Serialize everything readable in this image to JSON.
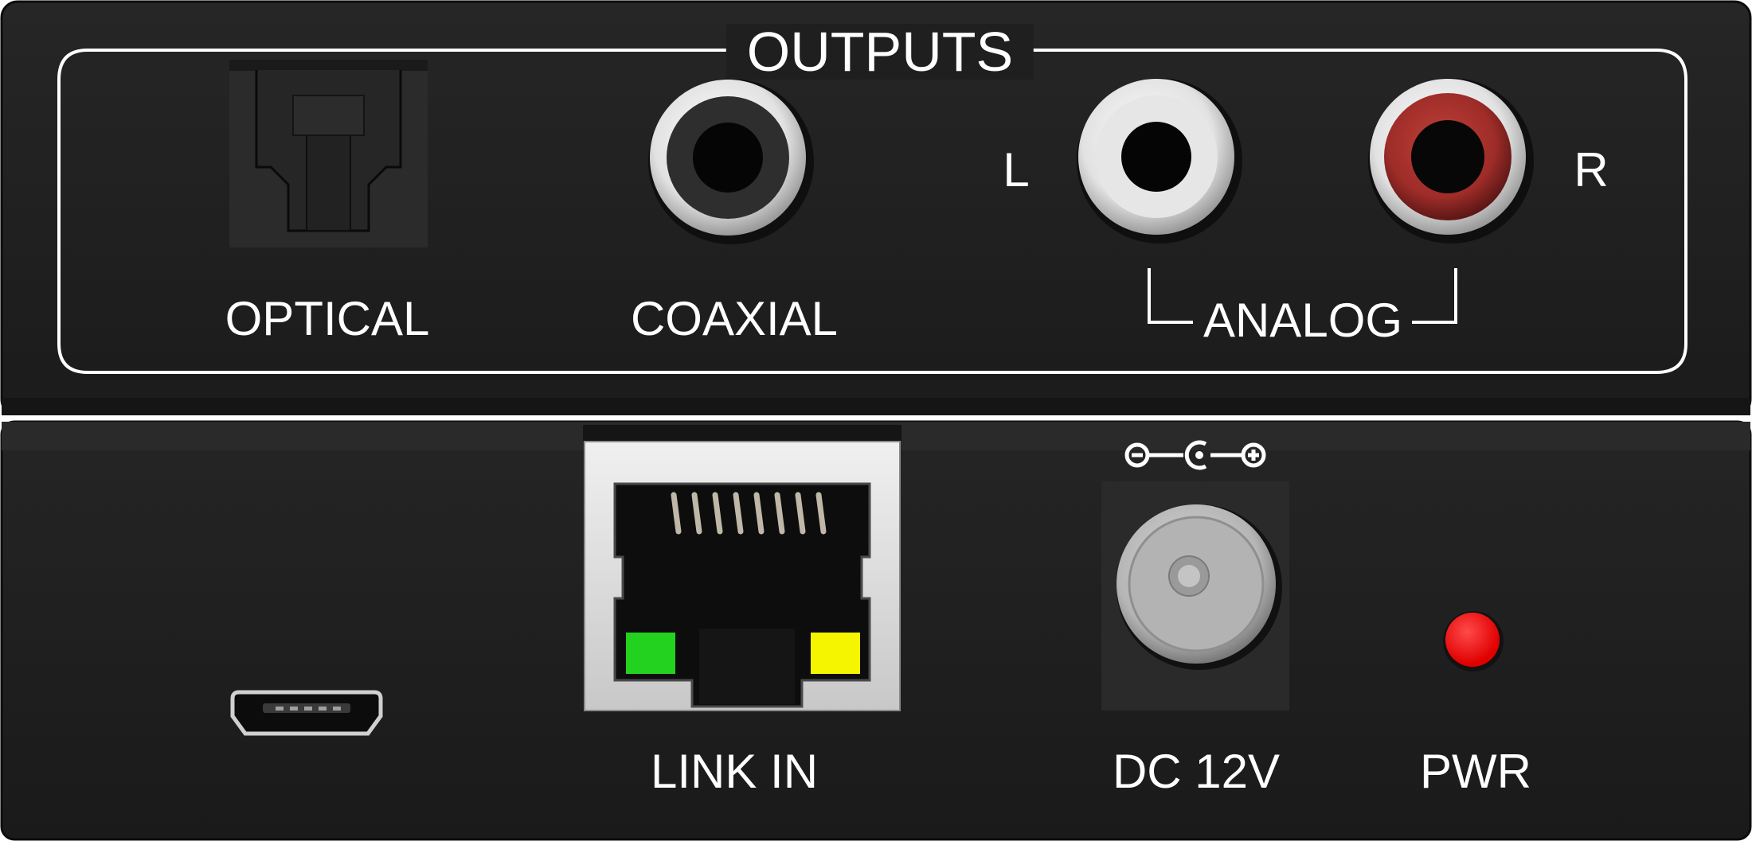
{
  "top_panel": {
    "title": "OUTPUTS",
    "ports": {
      "optical": {
        "label": "OPTICAL"
      },
      "coaxial": {
        "label": "COAXIAL"
      },
      "analog": {
        "label": "ANALOG",
        "left": "L",
        "right": "R"
      }
    }
  },
  "bottom_panel": {
    "link_in": {
      "label": "LINK IN",
      "leds": [
        "#23d11f",
        "#f5f500"
      ]
    },
    "dc": {
      "label": "DC 12V"
    },
    "pwr": {
      "label": "PWR",
      "color": "#ff0a0a"
    }
  },
  "colors": {
    "chassis": "#1f1f1f",
    "red_rca": "#a8302c",
    "white_rca": "#e8e8e8"
  }
}
